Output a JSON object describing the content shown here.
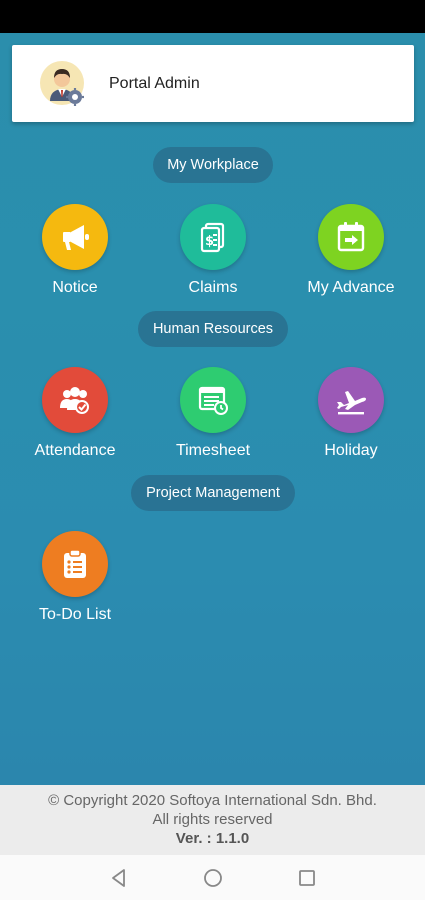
{
  "profile": {
    "name": "Portal Admin",
    "avatar_icon": "admin-avatar-icon"
  },
  "sections": [
    {
      "title": "My Workplace"
    },
    {
      "title": "Human Resources"
    },
    {
      "title": "Project Management"
    }
  ],
  "tiles": {
    "notice": {
      "label": "Notice",
      "icon": "megaphone-icon",
      "color": "#f5b90f"
    },
    "claims": {
      "label": "Claims",
      "icon": "receipt-dollar-icon",
      "color": "#1fbc9a"
    },
    "my_advance": {
      "label": "My Advance",
      "icon": "calendar-arrow-icon",
      "color": "#7ed321"
    },
    "attendance": {
      "label": "Attendance",
      "icon": "group-check-icon",
      "color": "#e24b3a"
    },
    "timesheet": {
      "label": "Timesheet",
      "icon": "timesheet-clock-icon",
      "color": "#2ecc71"
    },
    "holiday": {
      "label": "Holiday",
      "icon": "airplane-icon",
      "color": "#9b59b6"
    },
    "todo_list": {
      "label": "To-Do List",
      "icon": "clipboard-list-icon",
      "color": "#ee7d21"
    }
  },
  "footer": {
    "copyright": "© Copyright 2020 Softoya International Sdn. Bhd.",
    "rights": "All rights reserved",
    "version": "Ver. : 1.1.0"
  },
  "nav": {
    "back_icon": "back-triangle-icon",
    "home_icon": "home-circle-icon",
    "recents_icon": "recents-square-icon"
  }
}
